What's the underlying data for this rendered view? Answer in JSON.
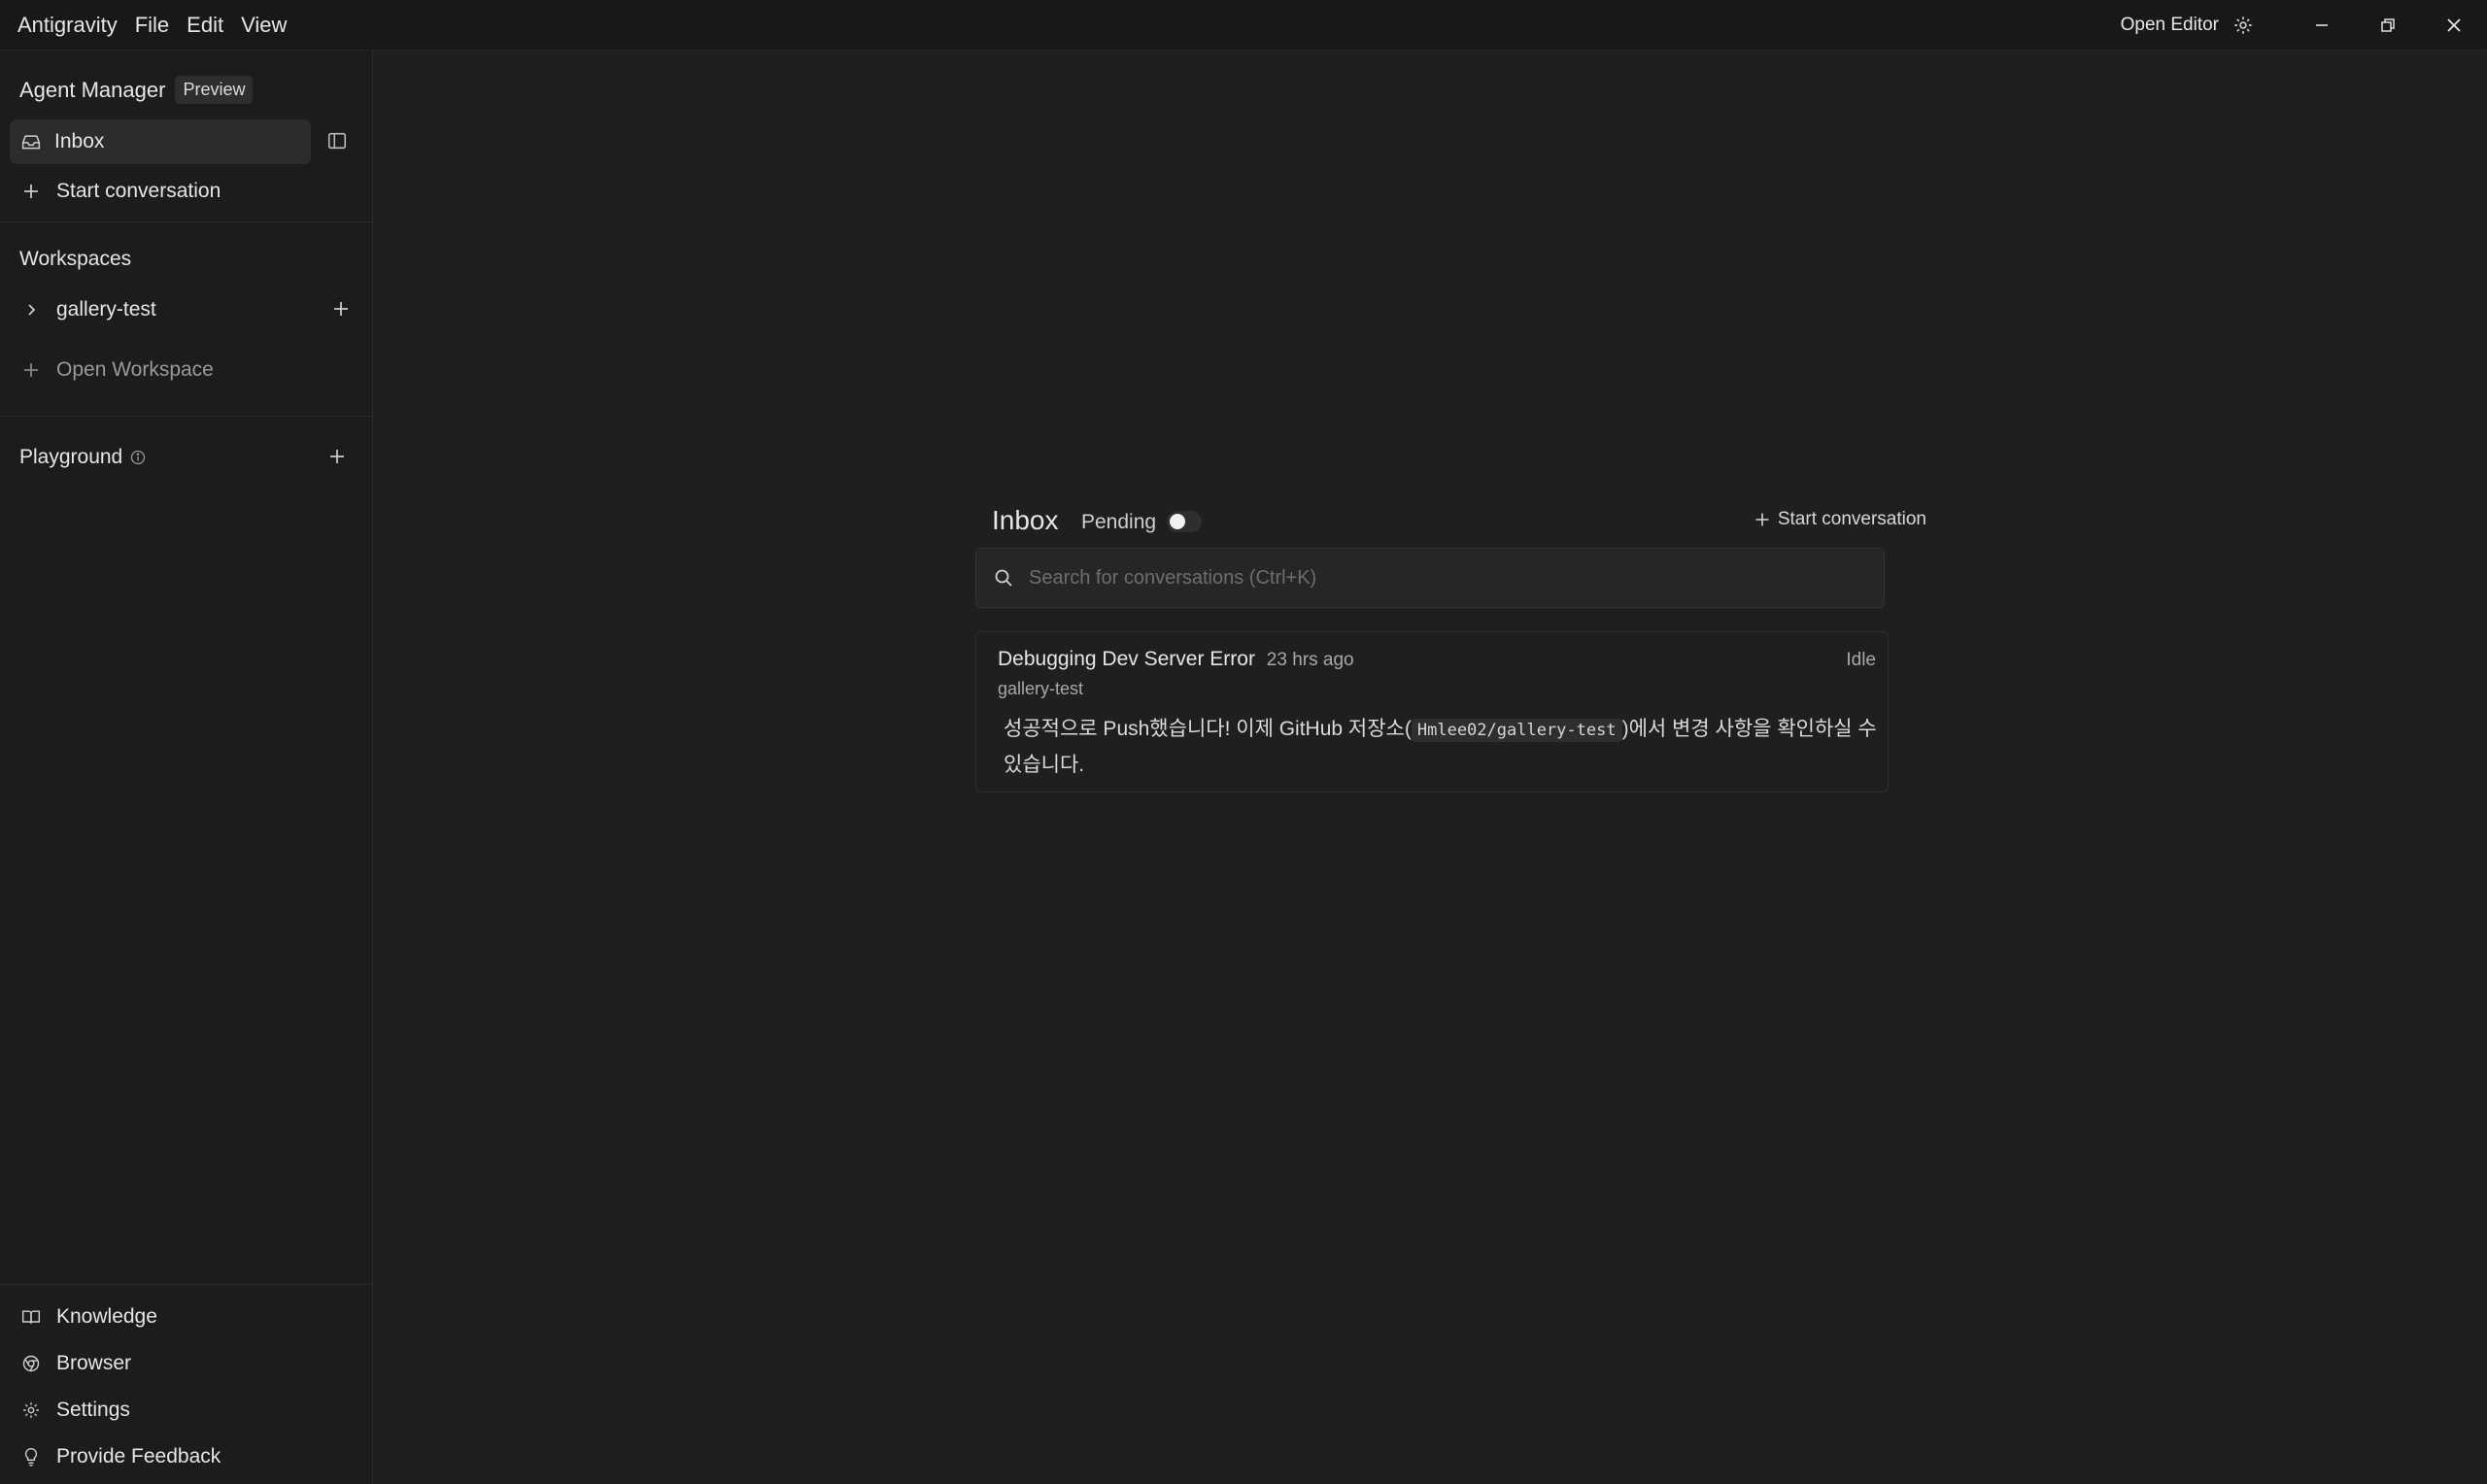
{
  "titlebar": {
    "menu": [
      "Antigravity",
      "File",
      "Edit",
      "View"
    ],
    "open_editor": "Open Editor"
  },
  "sidebar": {
    "title": "Agent Manager",
    "badge": "Preview",
    "inbox_label": "Inbox",
    "start_conversation": "Start conversation",
    "workspaces_label": "Workspaces",
    "workspace_item": "gallery-test",
    "open_workspace": "Open Workspace",
    "playground_label": "Playground",
    "bottom": {
      "knowledge": "Knowledge",
      "browser": "Browser",
      "settings": "Settings",
      "feedback": "Provide Feedback"
    }
  },
  "inbox": {
    "title": "Inbox",
    "pending_label": "Pending",
    "pending_on": false,
    "start_conversation": "Start conversation",
    "search_placeholder": "Search for conversations (Ctrl+K)"
  },
  "conversation": {
    "title": "Debugging Dev Server Error",
    "time": "23 hrs ago",
    "status": "Idle",
    "workspace": "gallery-test",
    "body_before": "성공적으로 Push했습니다! 이제 GitHub 저장소(",
    "body_code": "Hmlee02/gallery-test",
    "body_after": ")에서 변경 사항을 확인하실 수 있습니다."
  }
}
